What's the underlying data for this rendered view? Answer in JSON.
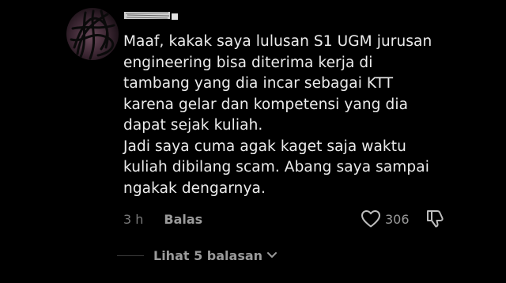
{
  "comment": {
    "text": "Maaf, kakak saya lulusan S1 UGM jurusan\nengineering bisa diterima kerja di\ntambang yang dia incar sebagai KTT\nkarena gelar dan kompetensi yang dia\ndapat sejak kuliah.\nJadi saya cuma agak kaget saja waktu\nkuliah dibilang scam. Abang saya sampai\nngakak dengarnya.",
    "timestamp": "3 h",
    "reply_label": "Balas",
    "like_count": "306",
    "replies_label": "Lihat 5 balasan"
  },
  "icons": {
    "avatar": "avatar-scribbled",
    "username": "username-redacted",
    "like": "heart-outline-icon",
    "dislike": "thumbs-down-outline-icon",
    "expand": "chevron-down-icon"
  },
  "colors": {
    "background": "#000000",
    "text_primary": "#ececec",
    "text_secondary": "#9a9a9a"
  }
}
